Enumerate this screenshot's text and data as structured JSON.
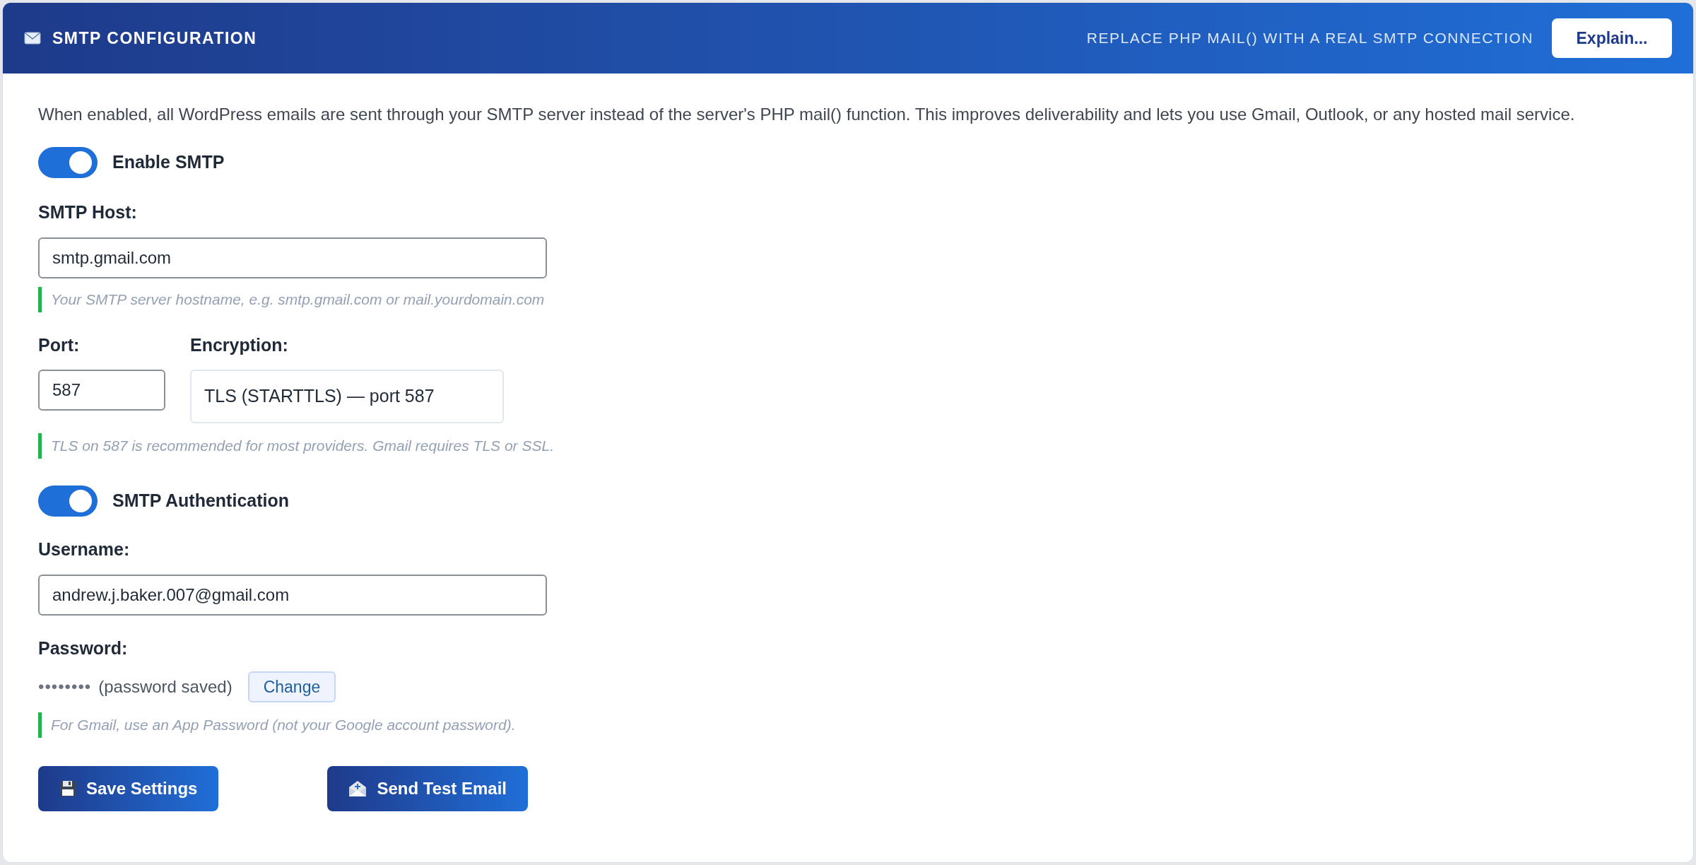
{
  "header": {
    "title": "SMTP CONFIGURATION",
    "tagline": "REPLACE PHP MAIL() WITH A REAL SMTP CONNECTION",
    "button": "Explain..."
  },
  "description": "When enabled, all WordPress emails are sent through your SMTP server instead of the server's PHP mail() function. This improves deliverability and lets you use Gmail, Outlook, or any hosted mail service.",
  "enable_smtp": {
    "label": "Enable SMTP",
    "on": true
  },
  "host": {
    "label": "SMTP Host:",
    "value": "smtp.gmail.com",
    "hint": "Your SMTP server hostname, e.g. smtp.gmail.com or mail.yourdomain.com"
  },
  "port": {
    "label": "Port:",
    "value": "587"
  },
  "encryption": {
    "label": "Encryption:",
    "value": "TLS (STARTTLS) — port 587"
  },
  "port_hint": "TLS on 587 is recommended for most providers. Gmail requires TLS or SSL.",
  "auth": {
    "label": "SMTP Authentication",
    "on": true
  },
  "username": {
    "label": "Username:",
    "value": "andrew.j.baker.007@gmail.com"
  },
  "password": {
    "label": "Password:",
    "mask": "••••••••",
    "status": "(password saved)",
    "button": "Change",
    "hint": "For Gmail, use an App Password (not your Google account password)."
  },
  "actions": [
    {
      "kind": "save",
      "label": "Save Settings"
    },
    {
      "kind": "test",
      "label": "Send Test Email"
    }
  ]
}
